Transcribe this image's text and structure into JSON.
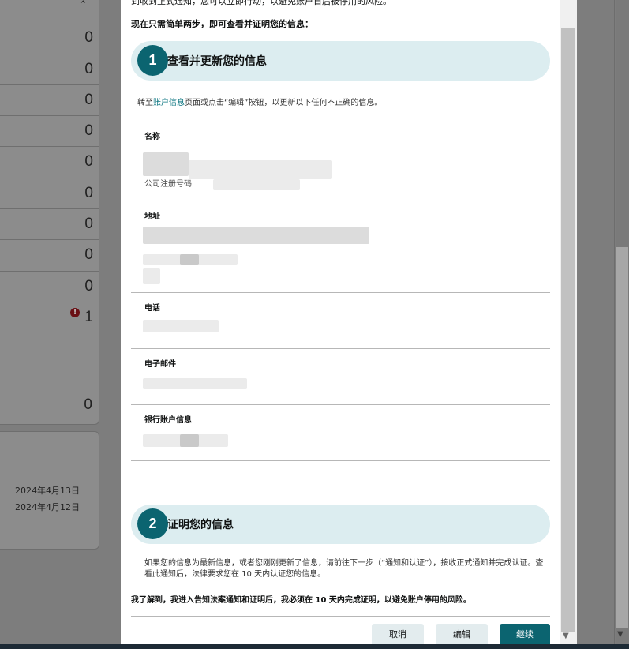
{
  "background": {
    "counts": [
      "0",
      "0",
      "0",
      "0",
      "0",
      "0",
      "0",
      "0",
      "0",
      "1"
    ],
    "extra_count": "0",
    "dates": [
      "2024年4月13日",
      "2024年4月12日"
    ]
  },
  "modal": {
    "intro_top": "到收到正式通知，您可以立即行动，以避免账户日后被停用的风险。",
    "intro": "现在只需简单两步，即可查看并证明您的信息：",
    "step1": {
      "number": "1",
      "title": "查看并更新您的信息",
      "note_prefix": "转至",
      "note_link": "账户信息",
      "note_suffix": "页面或点击“编辑”按钮，以更新以下任何不正确的信息。"
    },
    "fields": {
      "name_label": "名称",
      "company_reg_label": "公司注册号码",
      "address_label": "地址",
      "phone_label": "电话",
      "email_label": "电子邮件",
      "bank_label": "银行账户信息"
    },
    "step2": {
      "number": "2",
      "title": "证明您的信息",
      "note": "如果您的信息为最新信息，或者您刚刚更新了信息，请前往下一步（“通知和认证”），接收正式通知并完成认证。查看此通知后，法律要求您在 10 天内认证您的信息。"
    },
    "acknowledgement": "我了解到，我进入告知法案通知和证明后，我必须在 10 天内完成证明，以避免账户停用的风险。",
    "buttons": {
      "cancel": "取消",
      "edit": "编辑",
      "continue": "继续"
    }
  },
  "colors": {
    "accent": "#0b6470",
    "step_bar": "#dcedf0",
    "link": "#0b7580"
  }
}
